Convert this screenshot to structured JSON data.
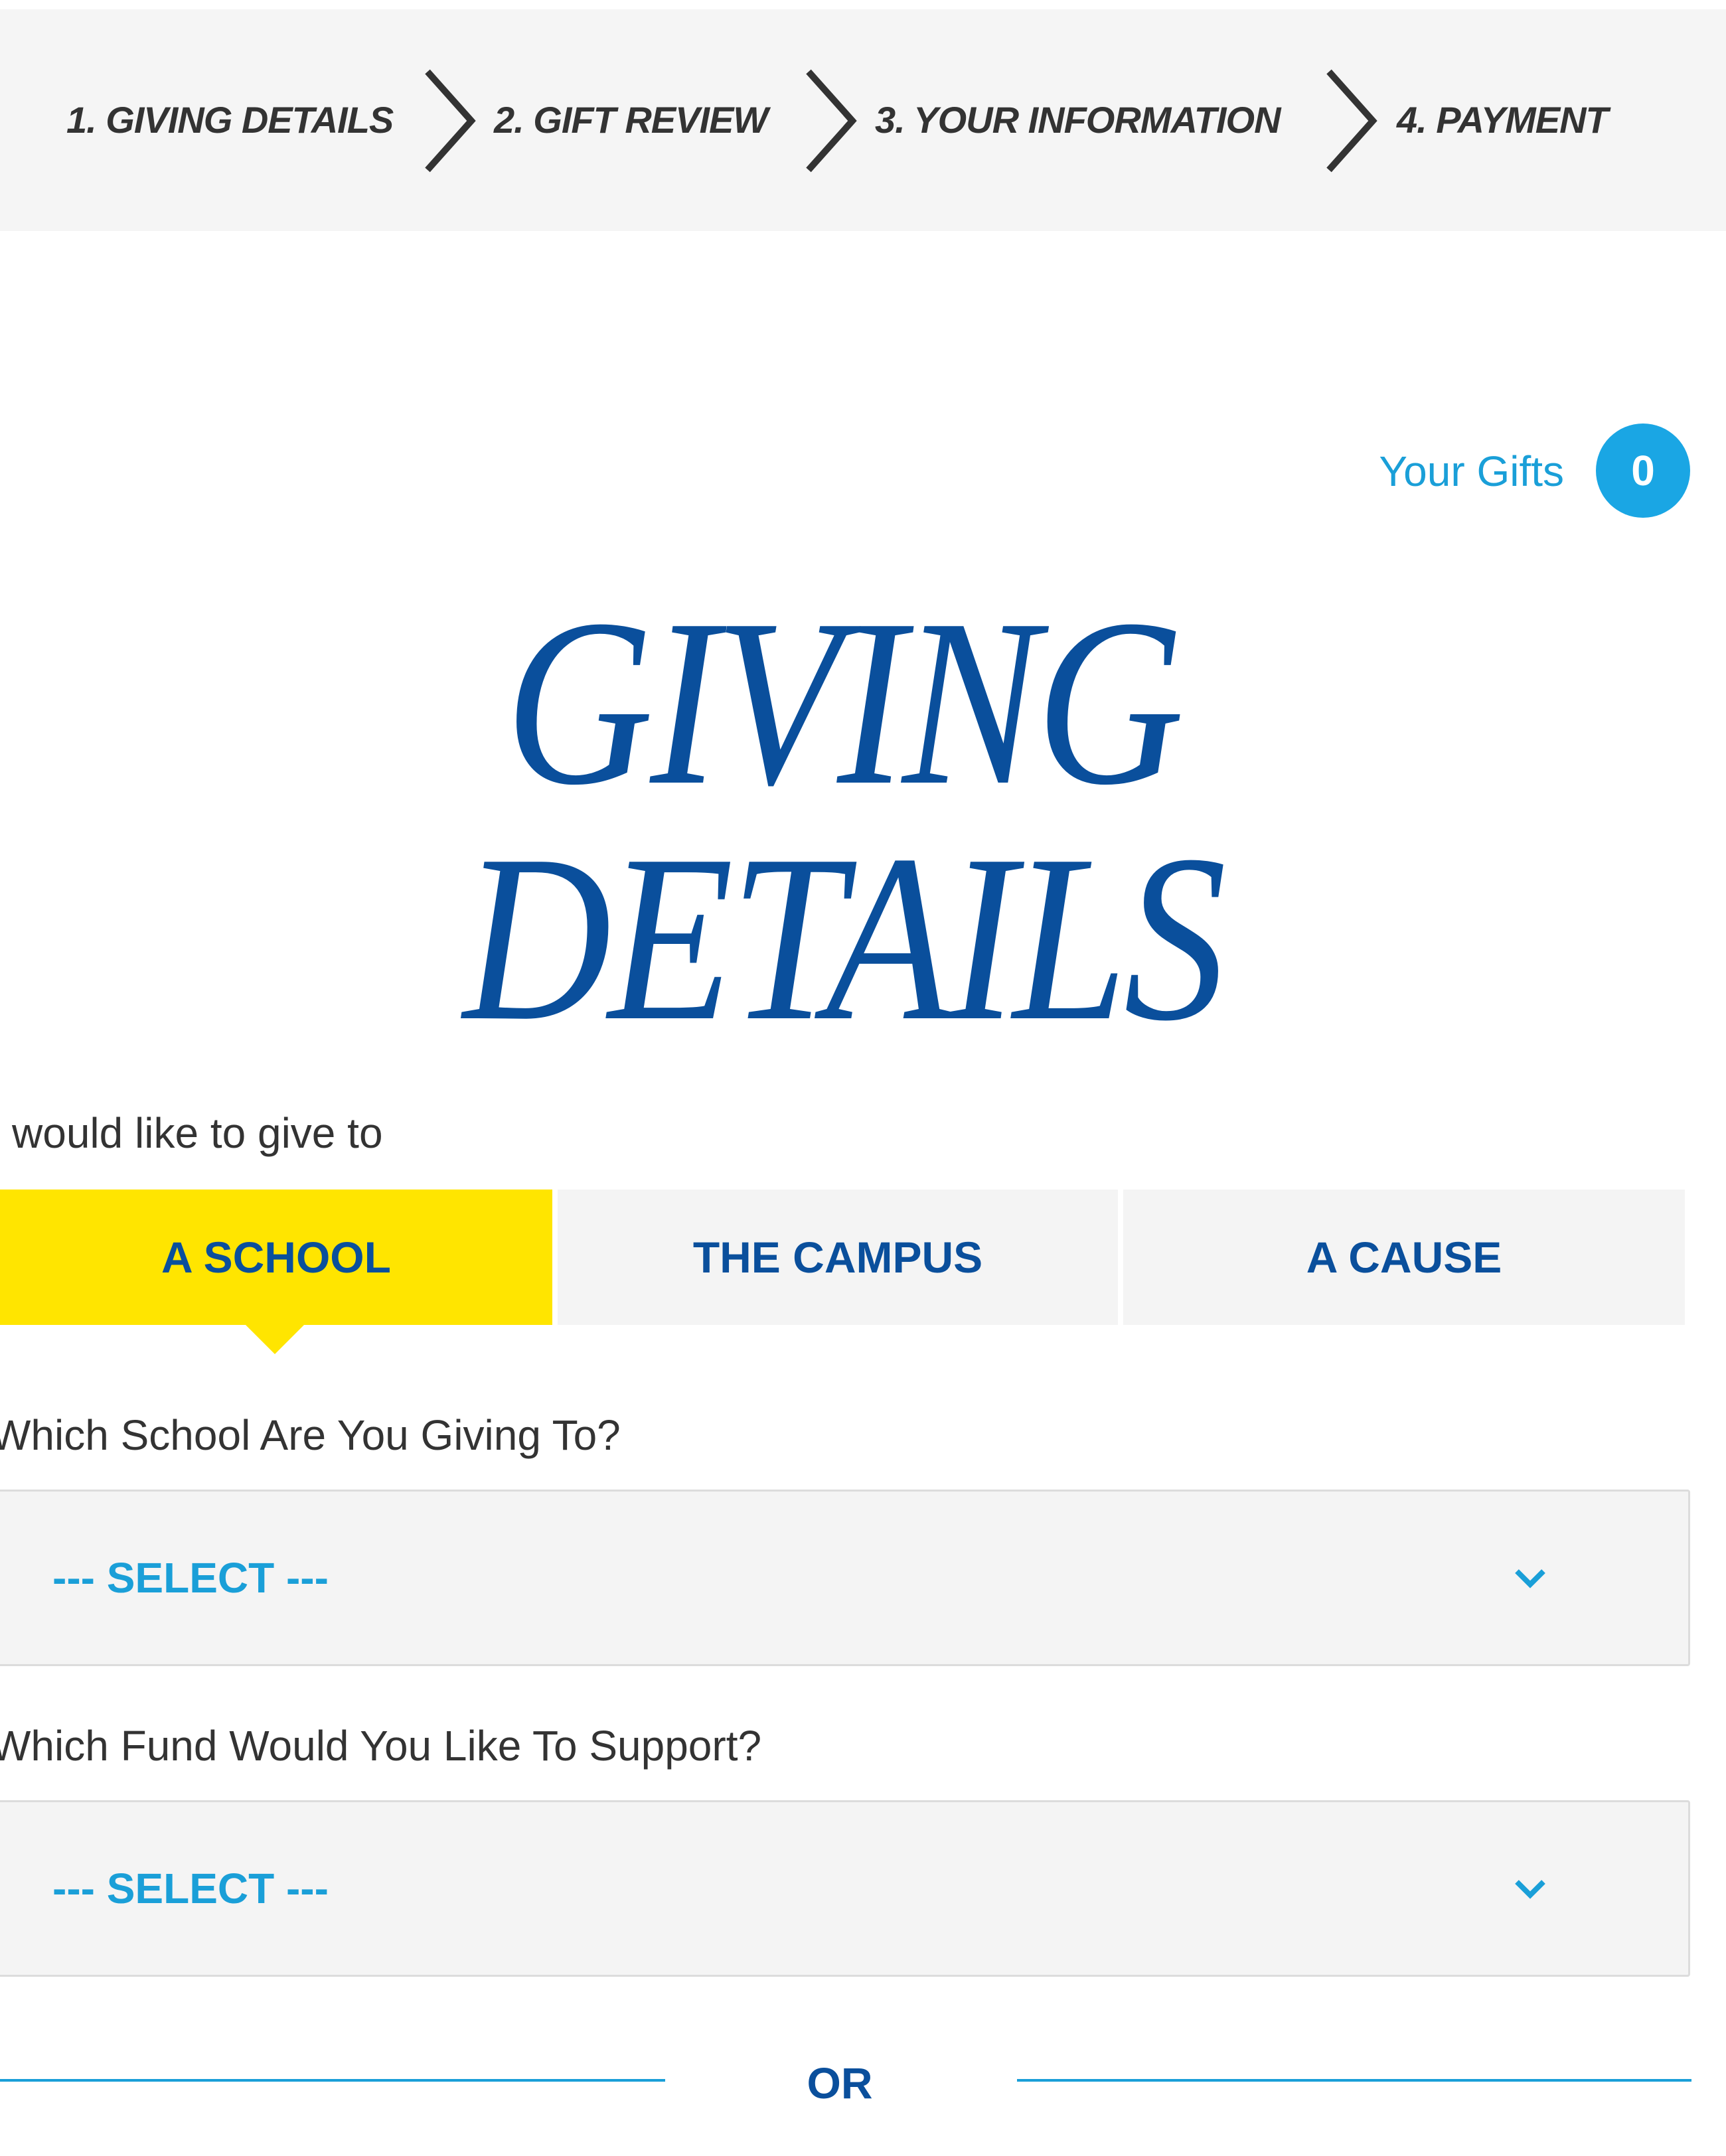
{
  "steps": [
    {
      "label": "1. GIVING DETAILS"
    },
    {
      "label": "2. GIFT REVIEW"
    },
    {
      "label": "3. YOUR INFORMATION"
    },
    {
      "label": "4. PAYMENT"
    }
  ],
  "gifts": {
    "label": "Your Gifts",
    "count": "0"
  },
  "title": {
    "line1": "GIVING",
    "line2": "DETAILS"
  },
  "intro": "would like to give to",
  "tabs": [
    {
      "label": "A SCHOOL",
      "active": true
    },
    {
      "label": "THE CAMPUS",
      "active": false
    },
    {
      "label": "A CAUSE",
      "active": false
    }
  ],
  "school_field": {
    "label": "Which School Are You Giving To?",
    "value": "--- SELECT ---"
  },
  "fund_field": {
    "label": "Which Fund Would You Like To Support?",
    "value": "--- SELECT ---"
  },
  "divider": {
    "text": "OR"
  },
  "colors": {
    "primary_blue": "#0a4f9c",
    "accent_blue": "#1a9fd8",
    "active_tab": "#ffe500",
    "panel_gray": "#f4f4f4"
  },
  "icons": [
    "chevron-right-icon",
    "chevron-down-icon"
  ]
}
